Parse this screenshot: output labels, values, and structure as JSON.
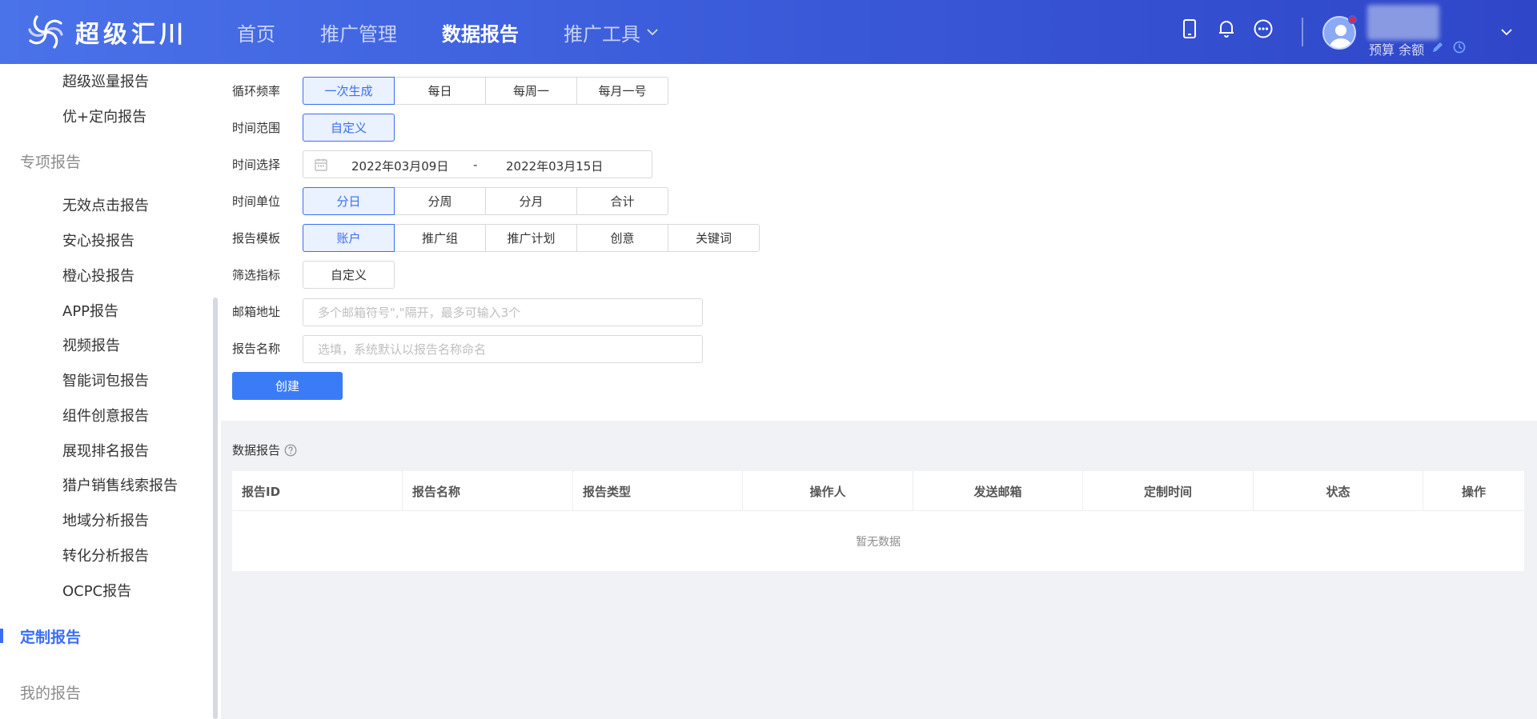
{
  "header": {
    "logo_text": "超级汇川",
    "nav": [
      {
        "label": "首页",
        "active": false
      },
      {
        "label": "推广管理",
        "active": false
      },
      {
        "label": "数据报告",
        "active": true
      },
      {
        "label": "推广工具",
        "active": false,
        "has_dropdown": true
      }
    ],
    "icons": [
      "mobile-icon",
      "bell-icon",
      "more-circle-icon"
    ],
    "user": {
      "balance_label": "预算 余额",
      "icons": [
        "avatar-icon",
        "edit-icon",
        "clock-icon",
        "chevron-down-icon"
      ]
    }
  },
  "sidebar": {
    "items_top": [
      "超级巡量报告",
      "优+定向报告"
    ],
    "group_special": "专项报告",
    "items_special": [
      "无效点击报告",
      "安心投报告",
      "橙心投报告",
      "APP报告",
      "视频报告",
      "智能词包报告",
      "组件创意报告",
      "展现排名报告",
      "猎户销售线索报告",
      "地域分析报告",
      "转化分析报告",
      "OCPC报告"
    ],
    "active_item": "定制报告",
    "group_mine": "我的报告"
  },
  "form": {
    "frequency": {
      "label": "循环频率",
      "options": [
        "一次生成",
        "每日",
        "每周一",
        "每月一号"
      ],
      "selected": 0
    },
    "range": {
      "label": "时间范围",
      "options": [
        "自定义"
      ],
      "selected": 0
    },
    "date": {
      "label": "时间选择",
      "start": "2022年03月09日",
      "separator": "-",
      "end": "2022年03月15日"
    },
    "unit": {
      "label": "时间单位",
      "options": [
        "分日",
        "分周",
        "分月",
        "合计"
      ],
      "selected": 0
    },
    "template": {
      "label": "报告模板",
      "options": [
        "账户",
        "推广组",
        "推广计划",
        "创意",
        "关键词"
      ],
      "selected": 0
    },
    "metrics": {
      "label": "筛选指标",
      "button": "自定义"
    },
    "email": {
      "label": "邮箱地址",
      "placeholder": "多个邮箱符号\",\"隔开，最多可输入3个",
      "value": ""
    },
    "name": {
      "label": "报告名称",
      "placeholder": "选填，系统默认以报告名称命名",
      "value": ""
    },
    "create_button": "创建"
  },
  "reports": {
    "title": "数据报告",
    "columns": [
      "报告ID",
      "报告名称",
      "报告类型",
      "操作人",
      "发送邮箱",
      "定制时间",
      "状态",
      "操作"
    ],
    "empty_text": "暂无数据"
  },
  "colors": {
    "primary": "#3a6ef6",
    "header_start": "#4a72e9",
    "header_end": "#2f46c9"
  }
}
